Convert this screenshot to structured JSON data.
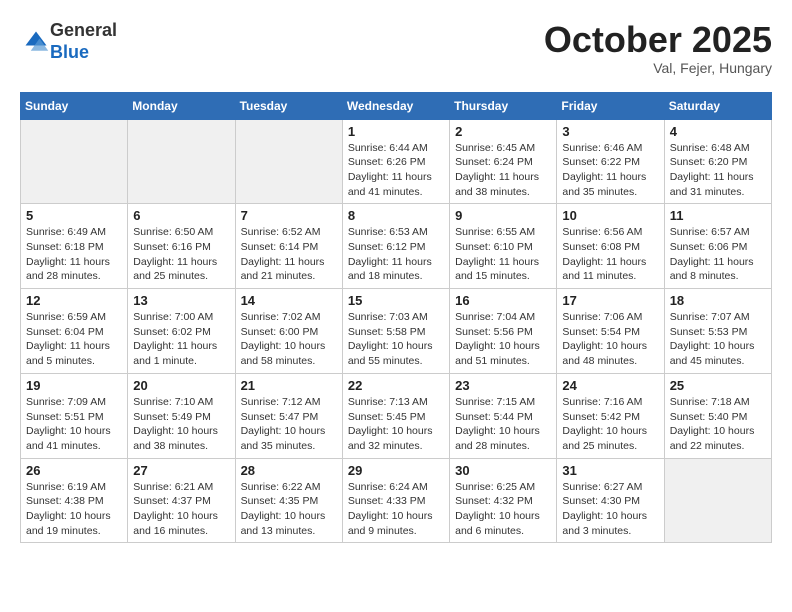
{
  "header": {
    "logo_line1": "General",
    "logo_line2": "Blue",
    "month": "October 2025",
    "location": "Val, Fejer, Hungary"
  },
  "weekdays": [
    "Sunday",
    "Monday",
    "Tuesday",
    "Wednesday",
    "Thursday",
    "Friday",
    "Saturday"
  ],
  "weeks": [
    [
      {
        "day": "",
        "detail": ""
      },
      {
        "day": "",
        "detail": ""
      },
      {
        "day": "",
        "detail": ""
      },
      {
        "day": "1",
        "detail": "Sunrise: 6:44 AM\nSunset: 6:26 PM\nDaylight: 11 hours\nand 41 minutes."
      },
      {
        "day": "2",
        "detail": "Sunrise: 6:45 AM\nSunset: 6:24 PM\nDaylight: 11 hours\nand 38 minutes."
      },
      {
        "day": "3",
        "detail": "Sunrise: 6:46 AM\nSunset: 6:22 PM\nDaylight: 11 hours\nand 35 minutes."
      },
      {
        "day": "4",
        "detail": "Sunrise: 6:48 AM\nSunset: 6:20 PM\nDaylight: 11 hours\nand 31 minutes."
      }
    ],
    [
      {
        "day": "5",
        "detail": "Sunrise: 6:49 AM\nSunset: 6:18 PM\nDaylight: 11 hours\nand 28 minutes."
      },
      {
        "day": "6",
        "detail": "Sunrise: 6:50 AM\nSunset: 6:16 PM\nDaylight: 11 hours\nand 25 minutes."
      },
      {
        "day": "7",
        "detail": "Sunrise: 6:52 AM\nSunset: 6:14 PM\nDaylight: 11 hours\nand 21 minutes."
      },
      {
        "day": "8",
        "detail": "Sunrise: 6:53 AM\nSunset: 6:12 PM\nDaylight: 11 hours\nand 18 minutes."
      },
      {
        "day": "9",
        "detail": "Sunrise: 6:55 AM\nSunset: 6:10 PM\nDaylight: 11 hours\nand 15 minutes."
      },
      {
        "day": "10",
        "detail": "Sunrise: 6:56 AM\nSunset: 6:08 PM\nDaylight: 11 hours\nand 11 minutes."
      },
      {
        "day": "11",
        "detail": "Sunrise: 6:57 AM\nSunset: 6:06 PM\nDaylight: 11 hours\nand 8 minutes."
      }
    ],
    [
      {
        "day": "12",
        "detail": "Sunrise: 6:59 AM\nSunset: 6:04 PM\nDaylight: 11 hours\nand 5 minutes."
      },
      {
        "day": "13",
        "detail": "Sunrise: 7:00 AM\nSunset: 6:02 PM\nDaylight: 11 hours\nand 1 minute."
      },
      {
        "day": "14",
        "detail": "Sunrise: 7:02 AM\nSunset: 6:00 PM\nDaylight: 10 hours\nand 58 minutes."
      },
      {
        "day": "15",
        "detail": "Sunrise: 7:03 AM\nSunset: 5:58 PM\nDaylight: 10 hours\nand 55 minutes."
      },
      {
        "day": "16",
        "detail": "Sunrise: 7:04 AM\nSunset: 5:56 PM\nDaylight: 10 hours\nand 51 minutes."
      },
      {
        "day": "17",
        "detail": "Sunrise: 7:06 AM\nSunset: 5:54 PM\nDaylight: 10 hours\nand 48 minutes."
      },
      {
        "day": "18",
        "detail": "Sunrise: 7:07 AM\nSunset: 5:53 PM\nDaylight: 10 hours\nand 45 minutes."
      }
    ],
    [
      {
        "day": "19",
        "detail": "Sunrise: 7:09 AM\nSunset: 5:51 PM\nDaylight: 10 hours\nand 41 minutes."
      },
      {
        "day": "20",
        "detail": "Sunrise: 7:10 AM\nSunset: 5:49 PM\nDaylight: 10 hours\nand 38 minutes."
      },
      {
        "day": "21",
        "detail": "Sunrise: 7:12 AM\nSunset: 5:47 PM\nDaylight: 10 hours\nand 35 minutes."
      },
      {
        "day": "22",
        "detail": "Sunrise: 7:13 AM\nSunset: 5:45 PM\nDaylight: 10 hours\nand 32 minutes."
      },
      {
        "day": "23",
        "detail": "Sunrise: 7:15 AM\nSunset: 5:44 PM\nDaylight: 10 hours\nand 28 minutes."
      },
      {
        "day": "24",
        "detail": "Sunrise: 7:16 AM\nSunset: 5:42 PM\nDaylight: 10 hours\nand 25 minutes."
      },
      {
        "day": "25",
        "detail": "Sunrise: 7:18 AM\nSunset: 5:40 PM\nDaylight: 10 hours\nand 22 minutes."
      }
    ],
    [
      {
        "day": "26",
        "detail": "Sunrise: 6:19 AM\nSunset: 4:38 PM\nDaylight: 10 hours\nand 19 minutes."
      },
      {
        "day": "27",
        "detail": "Sunrise: 6:21 AM\nSunset: 4:37 PM\nDaylight: 10 hours\nand 16 minutes."
      },
      {
        "day": "28",
        "detail": "Sunrise: 6:22 AM\nSunset: 4:35 PM\nDaylight: 10 hours\nand 13 minutes."
      },
      {
        "day": "29",
        "detail": "Sunrise: 6:24 AM\nSunset: 4:33 PM\nDaylight: 10 hours\nand 9 minutes."
      },
      {
        "day": "30",
        "detail": "Sunrise: 6:25 AM\nSunset: 4:32 PM\nDaylight: 10 hours\nand 6 minutes."
      },
      {
        "day": "31",
        "detail": "Sunrise: 6:27 AM\nSunset: 4:30 PM\nDaylight: 10 hours\nand 3 minutes."
      },
      {
        "day": "",
        "detail": ""
      }
    ]
  ]
}
